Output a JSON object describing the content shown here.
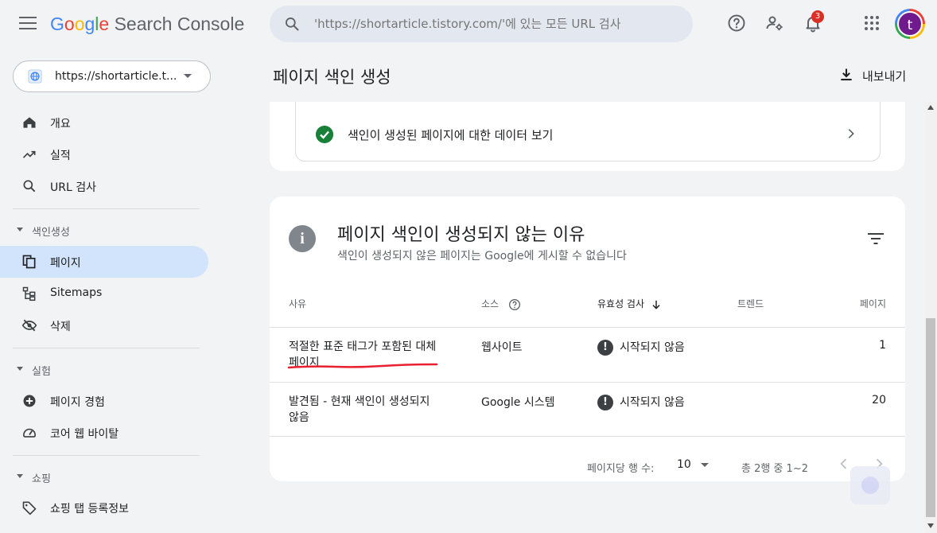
{
  "header": {
    "logo_google": [
      "G",
      "o",
      "o",
      "g",
      "l",
      "e"
    ],
    "logo_product": "Search Console",
    "search_placeholder": "'https://shortarticle.tistory.com/'에 있는 모든 URL 검사",
    "notification_count": "3",
    "avatar_letter": "t"
  },
  "sidebar": {
    "property_label": "https://shortarticle.t...",
    "items_top": [
      {
        "label": "개요",
        "icon": "home-icon"
      },
      {
        "label": "실적",
        "icon": "trending-up-icon"
      },
      {
        "label": "URL 검사",
        "icon": "search-icon"
      }
    ],
    "section_index": "색인생성",
    "items_index": [
      {
        "label": "페이지",
        "icon": "pages-icon",
        "active": true
      },
      {
        "label": "Sitemaps",
        "icon": "sitemap-icon"
      },
      {
        "label": "삭제",
        "icon": "eye-off-icon"
      }
    ],
    "section_experience": "실험",
    "items_experience": [
      {
        "label": "페이지 경험",
        "icon": "plus-circle-icon"
      },
      {
        "label": "코어 웹 바이탈",
        "icon": "gauge-icon"
      }
    ],
    "section_shopping": "쇼핑",
    "items_shopping": [
      {
        "label": "쇼핑 탭 등록정보",
        "icon": "tag-icon"
      }
    ]
  },
  "main": {
    "page_title": "페이지 색인 생성",
    "export_label": "내보내기",
    "valid_link": "색인이 생성된 페이지에 대한 데이터 보기",
    "reasons_card": {
      "title": "페이지 색인이 생성되지 않는 이유",
      "subtitle": "색인이 생성되지 않은 페이지는 Google에 게시할 수 없습니다",
      "columns": {
        "reason": "사유",
        "source": "소스",
        "validation": "유효성 검사",
        "trend": "트렌드",
        "pages": "페이지"
      },
      "rows": [
        {
          "reason": "적절한 표준 태그가 포함된 대체 페이지",
          "source": "웹사이트",
          "validation": "시작되지 않음",
          "pages": "1"
        },
        {
          "reason": "발견됨 - 현재 색인이 생성되지 않음",
          "source": "Google 시스템",
          "validation": "시작되지 않음",
          "pages": "20"
        }
      ],
      "pager": {
        "rows_per_page_label": "페이지당 행 수:",
        "rows_per_page": "10",
        "range": "총 2행 중 1~2"
      }
    }
  },
  "colors": {
    "accent": "#1a73e8",
    "active_nav": "#d2e3fc",
    "valid_green": "#188038",
    "underline_red": "#e8202f"
  }
}
